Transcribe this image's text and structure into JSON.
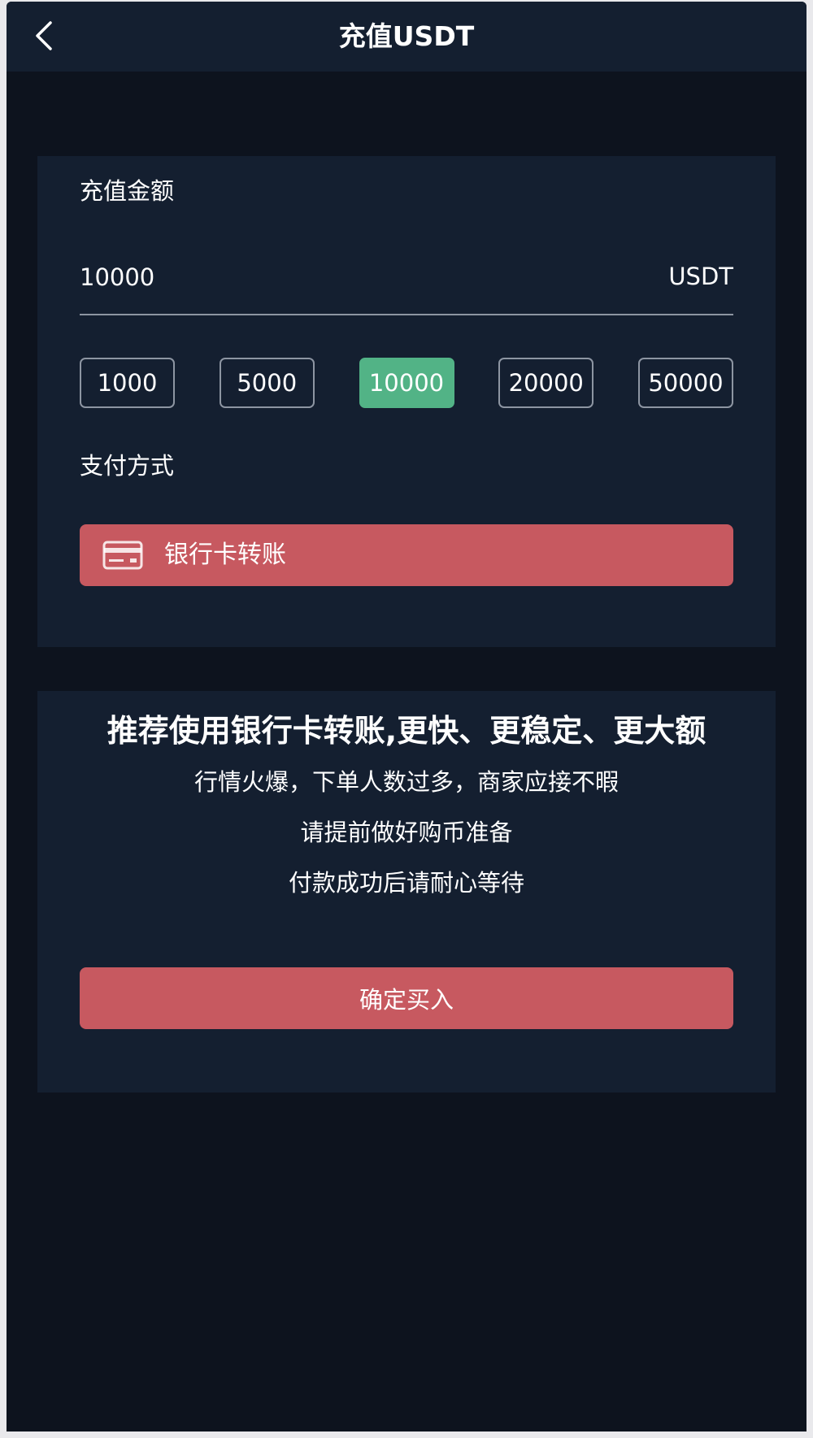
{
  "header": {
    "title": "充值USDT",
    "back_icon": "chevron-left-icon"
  },
  "amount_section": {
    "label": "充值金额",
    "input_value": "10000",
    "unit": "USDT",
    "presets": [
      "1000",
      "5000",
      "10000",
      "20000",
      "50000"
    ],
    "selected_preset": "10000"
  },
  "payment_section": {
    "label": "支付方式",
    "method_label": "银行卡转账",
    "method_icon": "bank-card-icon"
  },
  "info_section": {
    "headline": "推荐使用银行卡转账,更快、更稳定、更大额",
    "lines": [
      "行情火爆，下单人数过多，商家应接不暇",
      "请提前做好购币准备",
      "付款成功后请耐心等待"
    ],
    "confirm_label": "确定买入"
  },
  "colors": {
    "background": "#0d131e",
    "card": "#141f30",
    "accent_red": "#c75960",
    "accent_green": "#52b386",
    "border": "#8d95a2"
  }
}
